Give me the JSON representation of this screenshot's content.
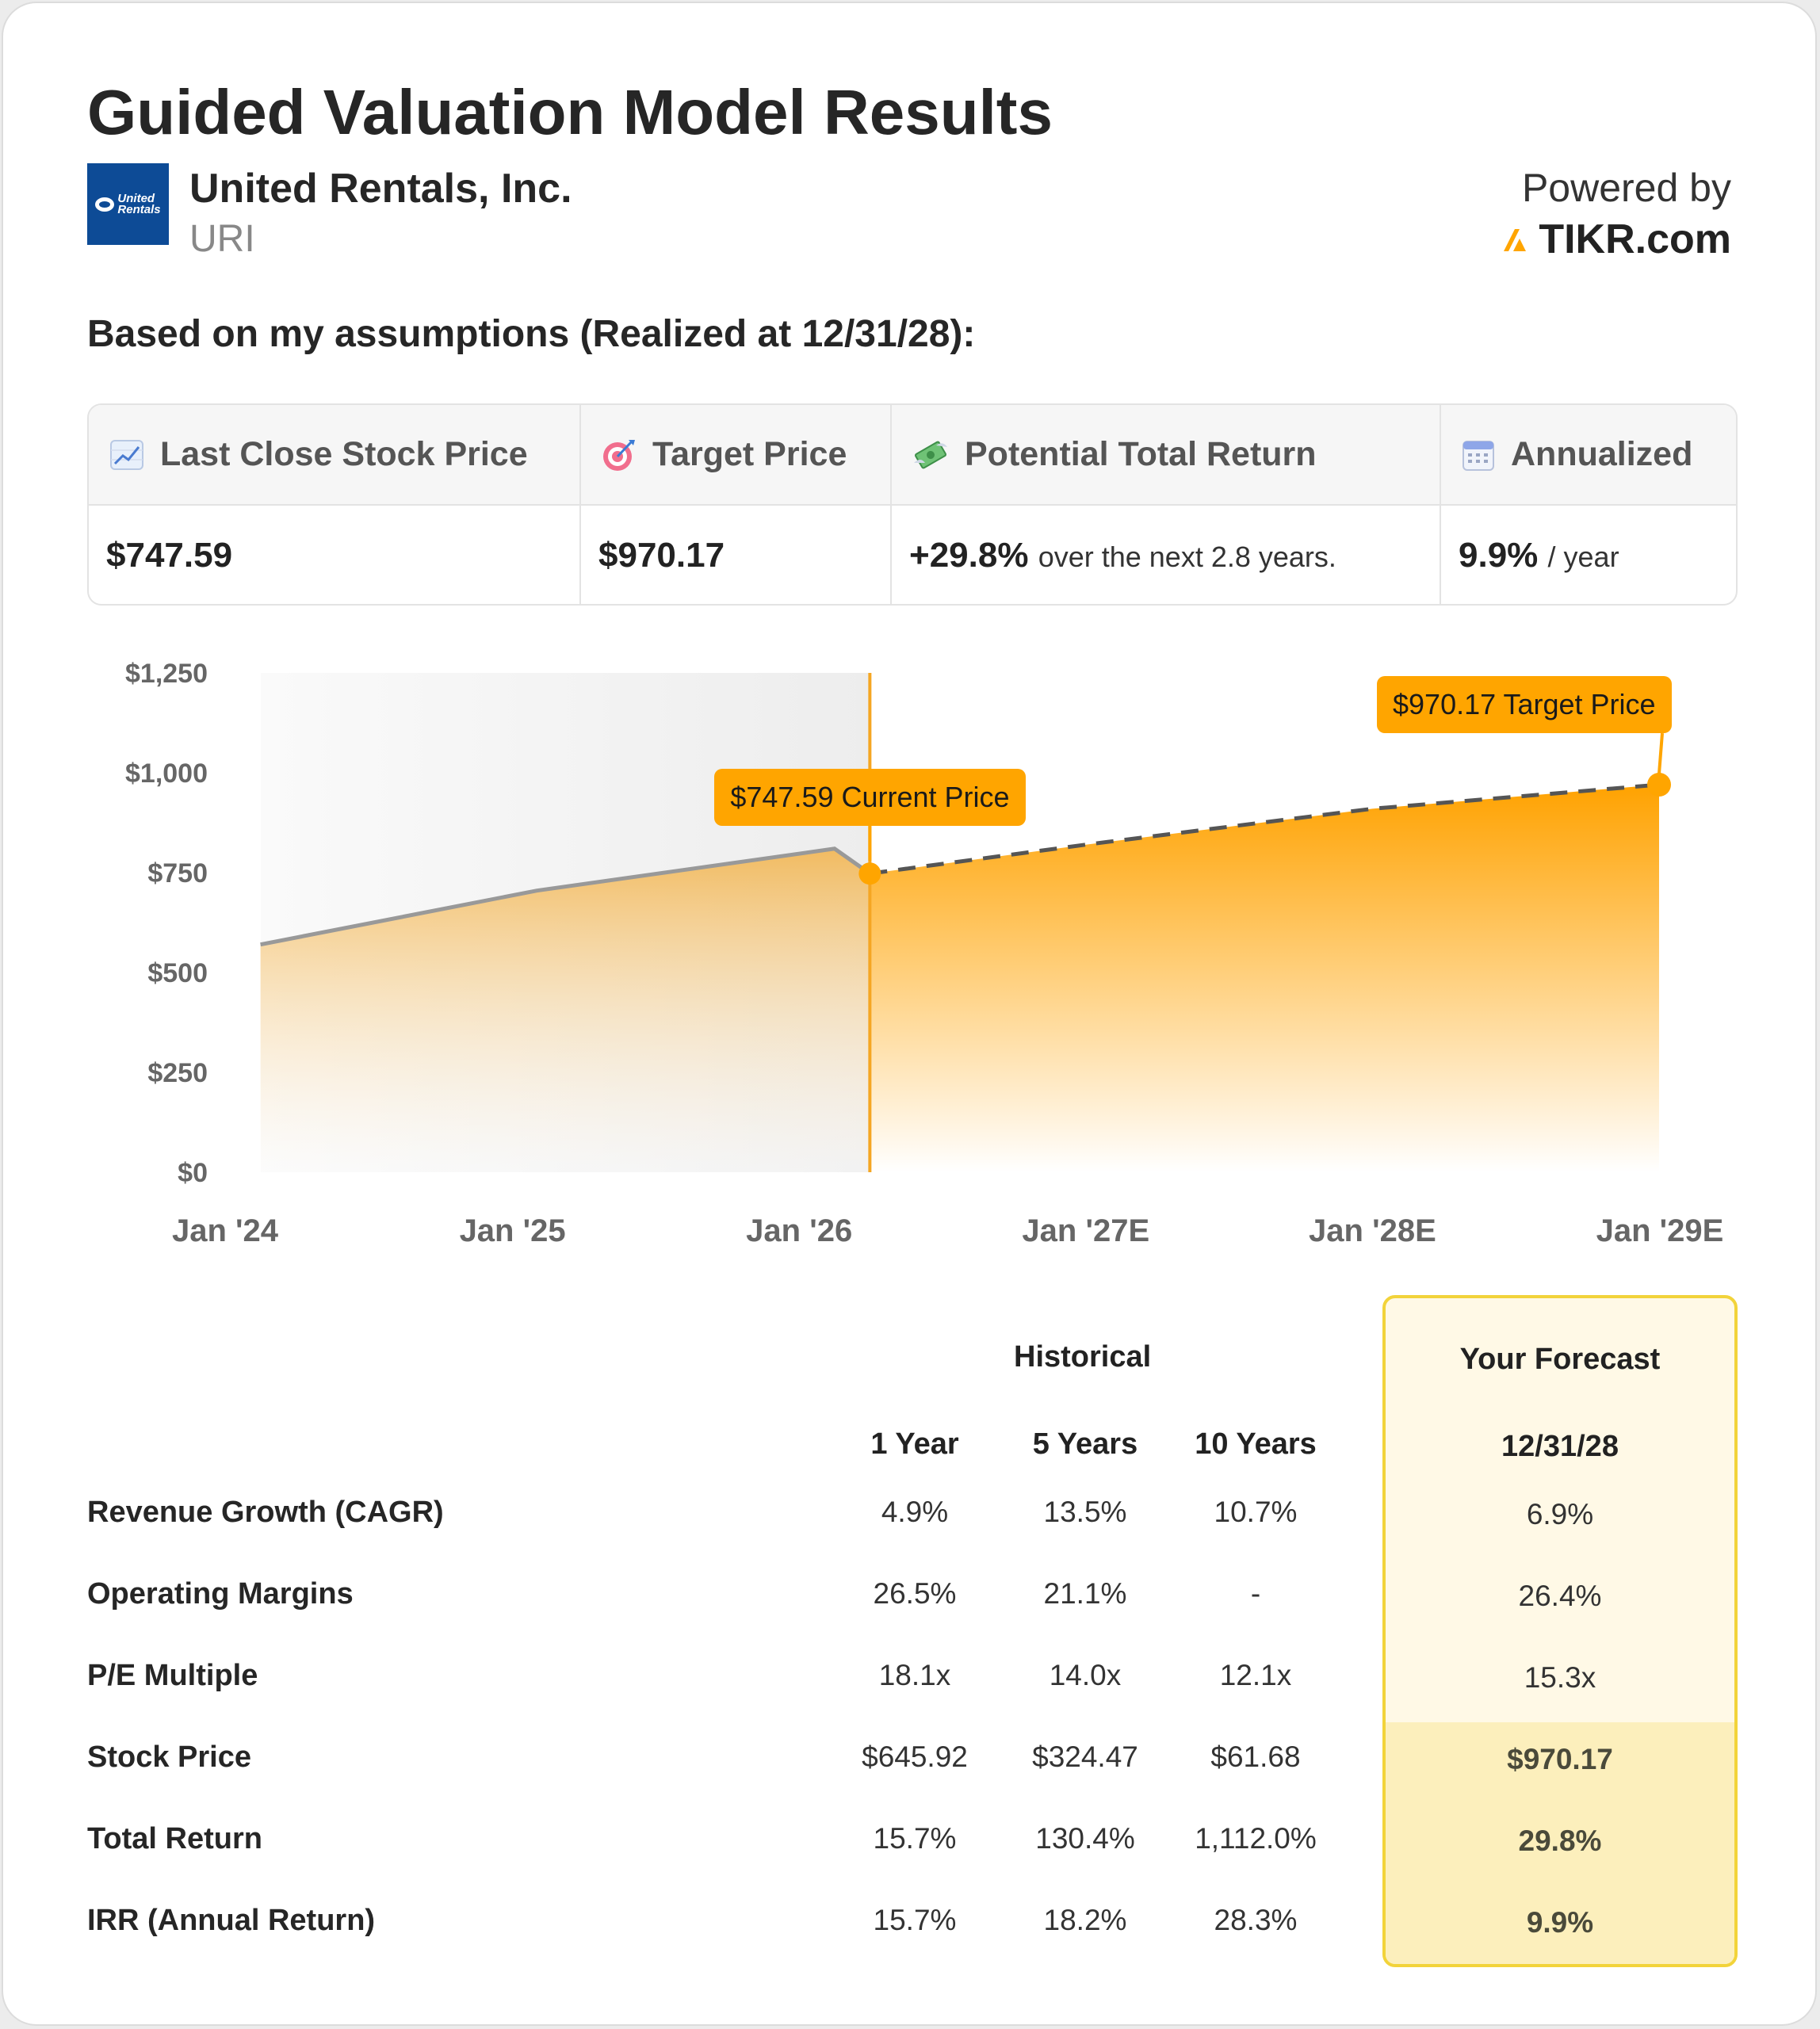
{
  "header": {
    "title": "Guided Valuation Model Results",
    "company_name": "United Rentals, Inc.",
    "ticker": "URI",
    "logo_text_1": "United",
    "logo_text_2": "Rentals",
    "powered_by": "Powered by",
    "brand": "TIKR.com",
    "brand_color": "#ffa500",
    "assumptions_label": "Based on my assumptions (Realized at 12/31/28):"
  },
  "summary": {
    "columns": [
      {
        "icon": "chart-increasing-icon",
        "label": "Last Close Stock Price",
        "value": "$747.59",
        "suffix": ""
      },
      {
        "icon": "target-icon",
        "label": "Target Price",
        "value": "$970.17",
        "suffix": ""
      },
      {
        "icon": "money-with-wings-icon",
        "label": "Potential Total Return",
        "value": "+29.8%",
        "suffix": "over the next 2.8 years."
      },
      {
        "icon": "calendar-icon",
        "label": "Annualized",
        "value": "9.9%",
        "suffix": "/ year"
      }
    ]
  },
  "chart_data": {
    "type": "area",
    "title": "",
    "xlabel": "",
    "ylabel": "",
    "ylim": [
      0,
      1250
    ],
    "y_ticks": [
      0,
      250,
      500,
      750,
      1000,
      1250
    ],
    "y_tick_labels": [
      "$0",
      "$250",
      "$500",
      "$750",
      "$1,000",
      "$1,250"
    ],
    "x_ticks": [
      "2024-01-01",
      "2025-01-01",
      "2026-01-01",
      "2027-01-01",
      "2028-01-01",
      "2029-01-01"
    ],
    "x_tick_labels": [
      "Jan '24",
      "Jan '25",
      "Jan '26",
      "Jan '27E",
      "Jan '28E",
      "Jan '29E"
    ],
    "grid": false,
    "colors": {
      "area": "#ffa500",
      "historical_line": "#999999",
      "forecast_line": "#555555",
      "marker": "#ffa500"
    },
    "series": [
      {
        "role": "historical",
        "points": [
          {
            "x": "2024-02-15",
            "y": 570
          },
          {
            "x": "2025-02-01",
            "y": 705
          },
          {
            "x": "2026-02-15",
            "y": 810
          },
          {
            "x": "2026-04-01",
            "y": 747.59
          }
        ]
      },
      {
        "role": "forecast",
        "points": [
          {
            "x": "2026-04-01",
            "y": 747.59
          },
          {
            "x": "2027-01-01",
            "y": 820
          },
          {
            "x": "2028-01-01",
            "y": 910
          },
          {
            "x": "2028-12-31",
            "y": 970.17
          }
        ]
      }
    ],
    "current_date": "2026-04-01",
    "annotations": [
      {
        "label": "$747.59 Current Price",
        "x": "2026-04-01",
        "y": 747.59
      },
      {
        "label": "$970.17 Target Price",
        "x": "2028-12-31",
        "y": 970.17
      }
    ]
  },
  "metrics": {
    "historical_label": "Historical",
    "forecast_label": "Your Forecast",
    "columns": [
      "1 Year",
      "5 Years",
      "10 Years"
    ],
    "forecast_date": "12/31/28",
    "rows": [
      {
        "label": "Revenue Growth (CAGR)",
        "values": [
          "4.9%",
          "13.5%",
          "10.7%"
        ],
        "forecast": "6.9%"
      },
      {
        "label": "Operating Margins",
        "values": [
          "26.5%",
          "21.1%",
          "-"
        ],
        "forecast": "26.4%"
      },
      {
        "label": "P/E Multiple",
        "values": [
          "18.1x",
          "14.0x",
          "12.1x"
        ],
        "forecast": "15.3x"
      },
      {
        "label": "Stock Price",
        "values": [
          "$645.92",
          "$324.47",
          "$61.68"
        ],
        "forecast": "$970.17"
      },
      {
        "label": "Total Return",
        "values": [
          "15.7%",
          "130.4%",
          "1,112.0%"
        ],
        "forecast": "29.8%"
      },
      {
        "label": "IRR (Annual Return)",
        "values": [
          "15.7%",
          "18.2%",
          "28.3%"
        ],
        "forecast": "9.9%"
      }
    ]
  }
}
